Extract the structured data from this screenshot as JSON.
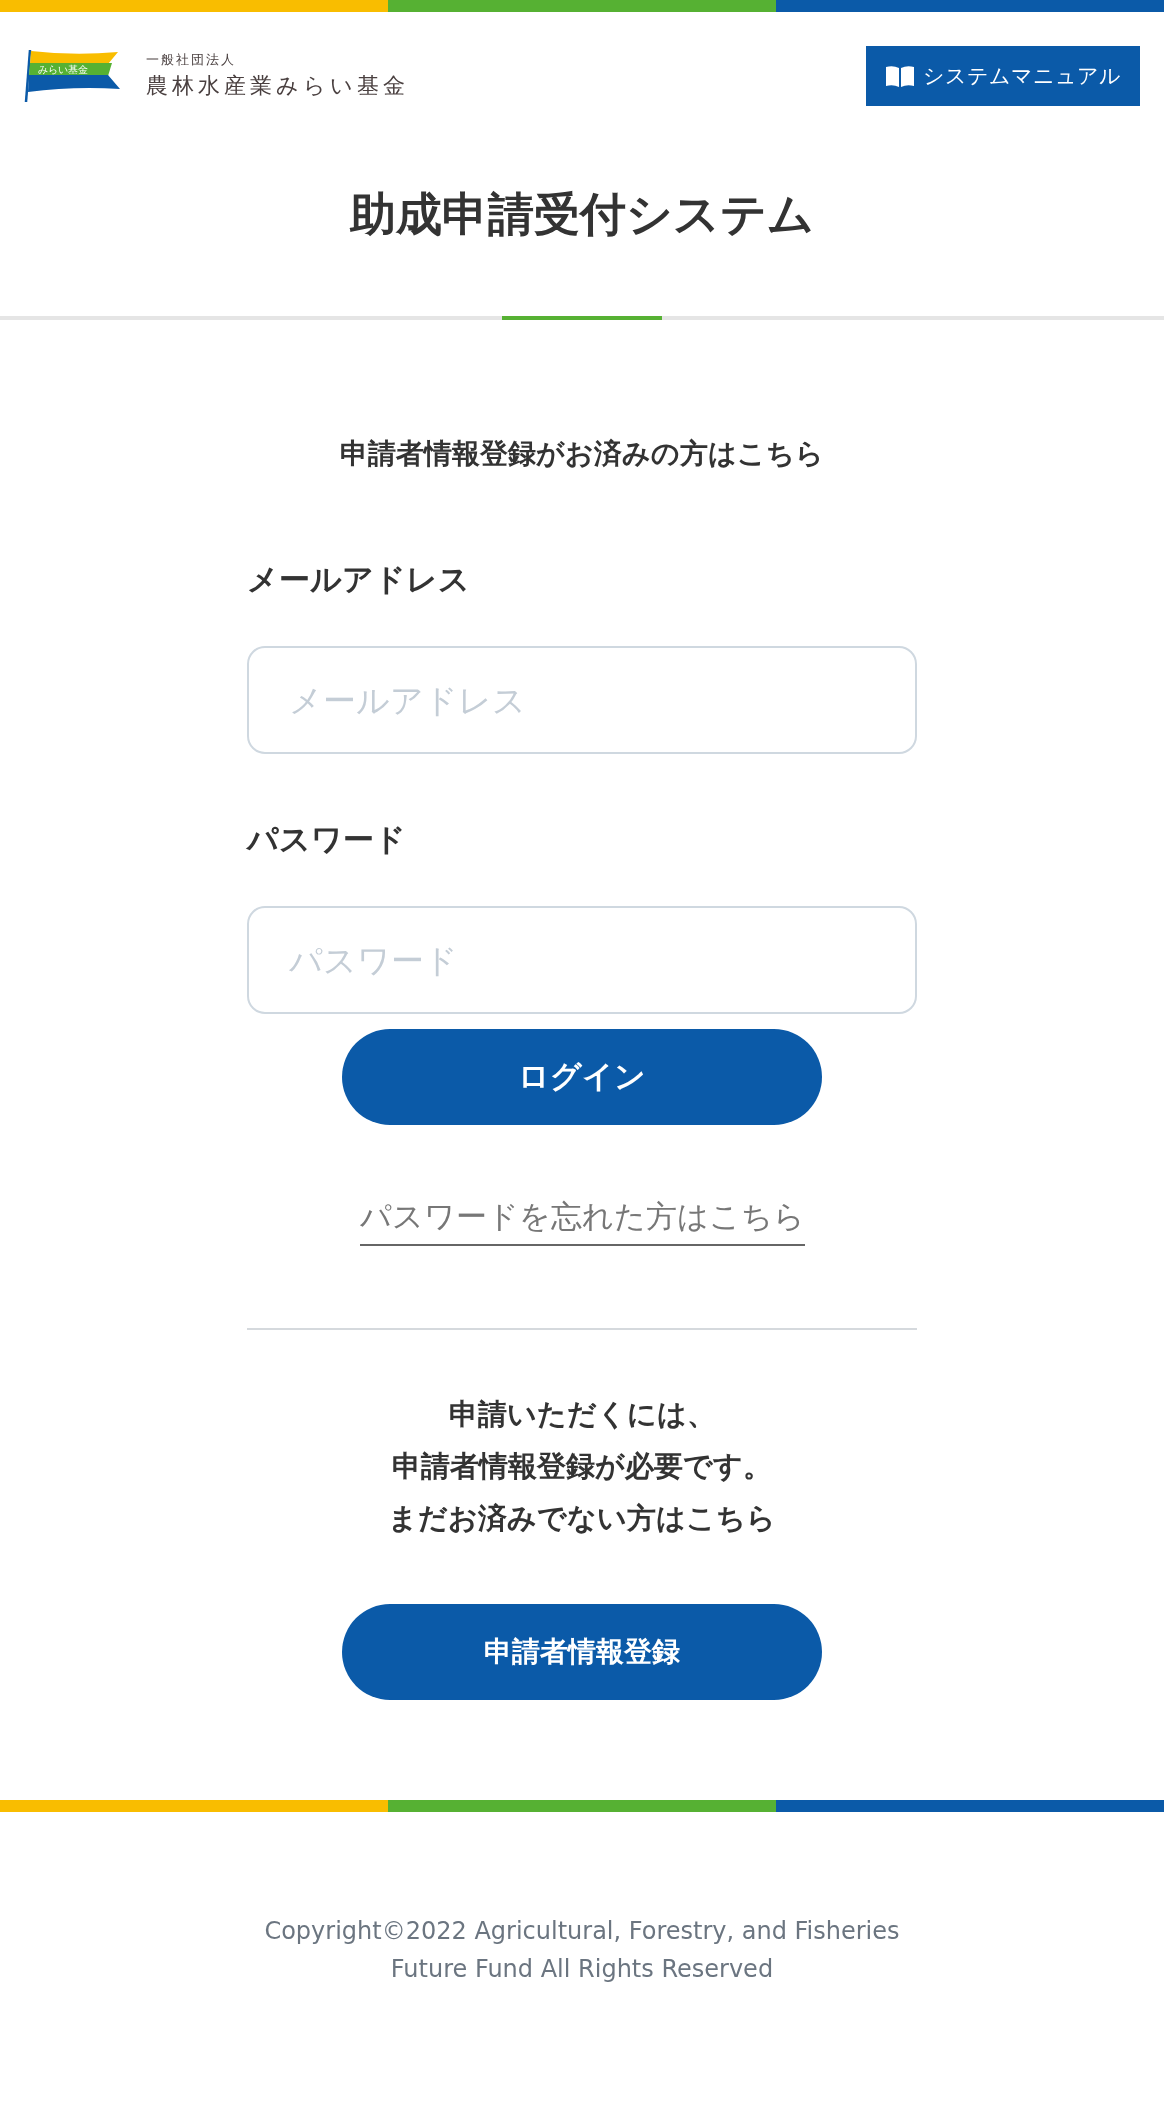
{
  "header": {
    "logo": {
      "flag_text": "みらい基金",
      "org_type": "一般社団法人",
      "org_name": "農林水産業みらい基金"
    },
    "manual_button": "システムマニュアル"
  },
  "title": "助成申請受付システム",
  "login": {
    "heading": "申請者情報登録がお済みの方はこちら",
    "fields": [
      {
        "label": "メールアドレス",
        "placeholder": "メールアドレス"
      },
      {
        "label": "パスワード",
        "placeholder": "パスワード"
      }
    ],
    "button": "ログイン",
    "forgot_link": "パスワードを忘れた方はこちら"
  },
  "register": {
    "lines": [
      "申請いただくには、",
      "申請者情報登録が必要です。",
      "まだお済みでない方はこちら"
    ],
    "button": "申請者情報登録"
  },
  "footer": {
    "lines": [
      "Copyright©2022 Agricultural, Forestry, and Fisheries",
      "Future Fund All Rights Reserved"
    ]
  }
}
